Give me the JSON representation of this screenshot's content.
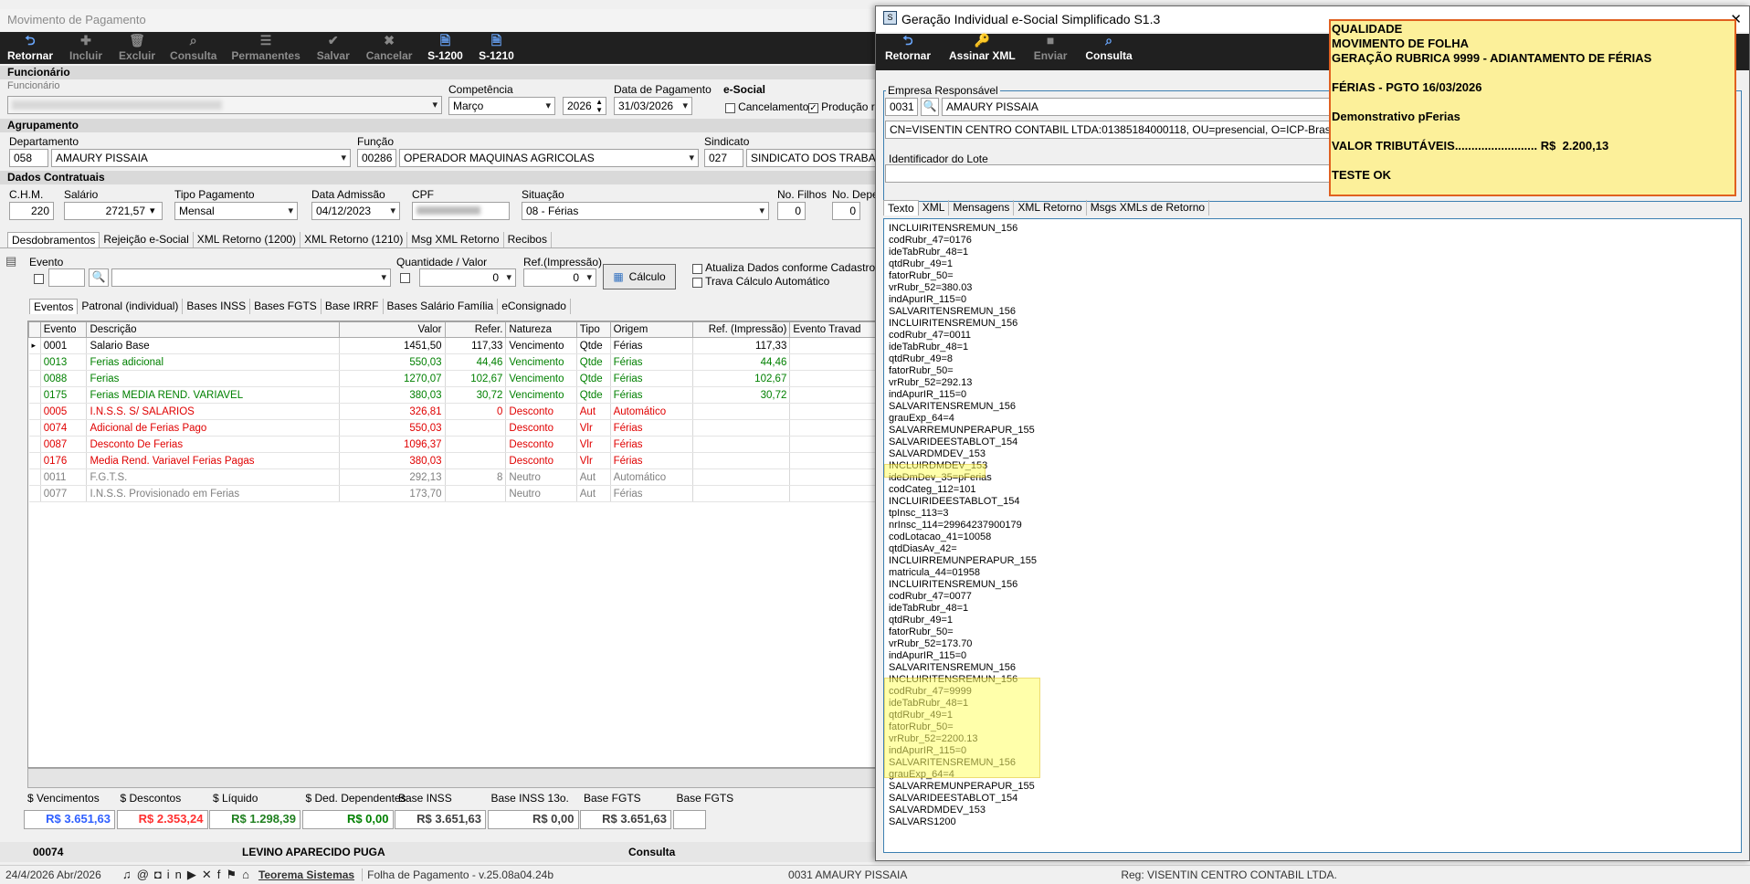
{
  "main": {
    "title": "Movimento de Pagamento",
    "toolbar": [
      {
        "label": "Retornar",
        "icon": "return-icon",
        "enabled": true
      },
      {
        "label": "Incluir",
        "icon": "plus-icon",
        "enabled": false
      },
      {
        "label": "Excluir",
        "icon": "trash-icon",
        "enabled": false
      },
      {
        "label": "Consulta",
        "icon": "search-icon",
        "enabled": false
      },
      {
        "label": "Permanentes",
        "icon": "list-icon",
        "enabled": false
      },
      {
        "label": "Salvar",
        "icon": "check-icon",
        "enabled": false
      },
      {
        "label": "Cancelar",
        "icon": "x-icon",
        "enabled": false
      },
      {
        "label": "S-1200",
        "icon": "doc-icon",
        "enabled": true
      },
      {
        "label": "S-1210",
        "icon": "doc-icon",
        "enabled": true
      }
    ],
    "funcionario_head": "Funcionário",
    "funcionario_label": "Funcionário",
    "competencia_label": "Competência",
    "competencia_mes": "Março",
    "competencia_ano": "2026",
    "data_pag_label": "Data de Pagamento",
    "data_pag": "31/03/2026",
    "esocial_label": "e-Social",
    "cancelamento_label": "Cancelamento",
    "producao_label": "Produção re",
    "agrupamento_head": "Agrupamento",
    "departamento_label": "Departamento",
    "departamento_cod": "058",
    "departamento_nome": "AMAURY PISSAIA",
    "funcao_label": "Função",
    "funcao_cod": "00286",
    "funcao_nome": "OPERADOR MAQUINAS AGRICOLAS",
    "sindicato_label": "Sindicato",
    "sindicato_cod": "027",
    "sindicato_nome": "SINDICATO DOS TRABALH",
    "contratuais_head": "Dados Contratuais",
    "chm_label": "C.H.M.",
    "chm": "220",
    "salario_label": "Salário",
    "salario": "2721,57",
    "tipo_pag_label": "Tipo Pagamento",
    "tipo_pag": "Mensal",
    "admissao_label": "Data Admissão",
    "admissao": "04/12/2023",
    "cpf_label": "CPF",
    "situacao_label": "Situação",
    "situacao": "08 - Férias",
    "filhos_label": "No. Filhos",
    "filhos": "0",
    "depe_label": "No. Depe",
    "depe": "0",
    "tabs1": [
      "Desdobramentos",
      "Rejeição e-Social",
      "XML Retorno (1200)",
      "XML Retorno (1210)",
      "Msg XML Retorno",
      "Recibos"
    ],
    "evento_label": "Evento",
    "qtd_label": "Quantidade / Valor",
    "qtd_val": "0",
    "ref_label": "Ref.(Impressão)",
    "ref_val": "0",
    "calculo_label": "Cálculo",
    "atualiza_label": "Atualiza Dados conforme Cadastro",
    "trava_label": "Trava Cálculo Automático",
    "tabs2": [
      "Eventos",
      "Patronal (individual)",
      "Bases INSS",
      "Bases FGTS",
      "Base IRRF",
      "Bases Salário Família",
      "eConsignado"
    ],
    "grid_headers": [
      "Evento",
      "Descrição",
      "Valor",
      "Refer.",
      "Natureza",
      "Tipo",
      "Origem",
      "Ref. (Impressão)",
      "Evento Travad"
    ],
    "rows": [
      {
        "ev": "0001",
        "desc": "Salario Base",
        "valor": "1451,50",
        "ref": "117,33",
        "nat": "Vencimento",
        "tipo": "Qtde",
        "orig": "Férias",
        "imp": "117,33",
        "color": "#000000"
      },
      {
        "ev": "0013",
        "desc": "Ferias adicional",
        "valor": "550,03",
        "ref": "44,46",
        "nat": "Vencimento",
        "tipo": "Qtde",
        "orig": "Férias",
        "imp": "44,46",
        "color": "#008000"
      },
      {
        "ev": "0088",
        "desc": "Ferias",
        "valor": "1270,07",
        "ref": "102,67",
        "nat": "Vencimento",
        "tipo": "Qtde",
        "orig": "Férias",
        "imp": "102,67",
        "color": "#008000"
      },
      {
        "ev": "0175",
        "desc": "Ferias MEDIA REND. VARIAVEL",
        "valor": "380,03",
        "ref": "30,72",
        "nat": "Vencimento",
        "tipo": "Qtde",
        "orig": "Férias",
        "imp": "30,72",
        "color": "#008000"
      },
      {
        "ev": "0005",
        "desc": "I.N.S.S. S/ SALARIOS",
        "valor": "326,81",
        "ref": "0",
        "nat": "Desconto",
        "tipo": "Aut",
        "orig": "Automático",
        "imp": "",
        "color": "#e00000"
      },
      {
        "ev": "0074",
        "desc": "Adicional de Ferias Pago",
        "valor": "550,03",
        "ref": "",
        "nat": "Desconto",
        "tipo": "Vlr",
        "orig": "Férias",
        "imp": "",
        "color": "#e00000"
      },
      {
        "ev": "0087",
        "desc": "Desconto De Ferias",
        "valor": "1096,37",
        "ref": "",
        "nat": "Desconto",
        "tipo": "Vlr",
        "orig": "Férias",
        "imp": "",
        "color": "#e00000"
      },
      {
        "ev": "0176",
        "desc": "Media  Rend. Variavel Ferias Pagas",
        "valor": "380,03",
        "ref": "",
        "nat": "Desconto",
        "tipo": "Vlr",
        "orig": "Férias",
        "imp": "",
        "color": "#e00000"
      },
      {
        "ev": "0011",
        "desc": "F.G.T.S.",
        "valor": "292,13",
        "ref": "8",
        "nat": "Neutro",
        "tipo": "Aut",
        "orig": "Automático",
        "imp": "",
        "color": "#808080"
      },
      {
        "ev": "0077",
        "desc": "I.N.S.S. Provisionado em Ferias",
        "valor": "173,70",
        "ref": "",
        "nat": "Neutro",
        "tipo": "Aut",
        "orig": "Férias",
        "imp": "",
        "color": "#808080"
      }
    ],
    "totals": [
      {
        "label": "$ Vencimentos",
        "value": "R$ 3.651,63",
        "color": "#3060ff"
      },
      {
        "label": "$ Descontos",
        "value": "R$ 2.353,24",
        "color": "#ff3030"
      },
      {
        "label": "$ Líquido",
        "value": "R$ 1.298,39",
        "color": "#208020"
      },
      {
        "label": "$ Ded. Dependentes",
        "value": "R$ 0,00",
        "color": "#008000"
      },
      {
        "label": "Base INSS",
        "value": "R$ 3.651,63",
        "color": "#404040"
      },
      {
        "label": "Base INSS 13o.",
        "value": "R$ 0,00",
        "color": "#404040"
      },
      {
        "label": "Base FGTS",
        "value": "R$ 3.651,63",
        "color": "#404040"
      },
      {
        "label": "Base FGTS",
        "value": "",
        "color": "#404040"
      }
    ],
    "footer_cod": "00074",
    "footer_nome": "LEVINO APARECIDO PUGA",
    "footer_mode": "Consulta"
  },
  "status": {
    "date": "24/4/2026 Abr/2026",
    "brand": "Teorema Sistemas",
    "version": "Folha de Pagamento - v.25.08a04.24b",
    "empresa": "0031 AMAURY  PISSAIA",
    "reg": "Reg: VISENTIN CENTRO CONTABIL LTDA."
  },
  "dialog": {
    "title": "Geração Individual e-Social Simplificado S1.3",
    "close": "✕",
    "toolbar": [
      {
        "label": "Retornar",
        "icon": "return-icon",
        "enabled": true
      },
      {
        "label": "Assinar XML",
        "icon": "key-icon",
        "enabled": true
      },
      {
        "label": "Enviar",
        "icon": "send-icon",
        "enabled": false
      },
      {
        "label": "Consulta",
        "icon": "search-icon",
        "enabled": true
      }
    ],
    "empresa_label": "Empresa Responsável",
    "empresa_cod": "0031",
    "empresa_nome": "AMAURY  PISSAIA",
    "certificado": "CN=VISENTIN CENTRO CONTABIL LTDA:01385184000118, OU=presencial, O=ICP-Brasil, C=BR, S",
    "lote_label": "Identificador do Lote",
    "tabs": [
      "Texto",
      "XML",
      "Mensagens",
      "XML Retorno",
      "Msgs XMLs de Retorno"
    ],
    "xml_lines": [
      "INCLUIRITENSREMUN_156",
      "codRubr_47=0176",
      "ideTabRubr_48=1",
      "qtdRubr_49=1",
      "fatorRubr_50=",
      "vrRubr_52=380.03",
      "indApurIR_115=0",
      "SALVARITENSREMUN_156",
      "INCLUIRITENSREMUN_156",
      "codRubr_47=0011",
      "ideTabRubr_48=1",
      "qtdRubr_49=8",
      "fatorRubr_50=",
      "vrRubr_52=292.13",
      "indApurIR_115=0",
      "SALVARITENSREMUN_156",
      "grauExp_64=4",
      "SALVARREMUNPERAPUR_155",
      "SALVARIDEESTABLOT_154",
      "SALVARDMDEV_153",
      "INCLUIRDMDEV_153",
      "ideDmDev_35=pFerias",
      "codCateg_112=101",
      "INCLUIRIDEESTABLOT_154",
      "tpInsc_113=3",
      "nrInsc_114=29964237900179",
      "codLotacao_41=10058",
      "qtdDiasAv_42=",
      "INCLUIRREMUNPERAPUR_155",
      "matricula_44=01958",
      "INCLUIRITENSREMUN_156",
      "codRubr_47=0077",
      "ideTabRubr_48=1",
      "qtdRubr_49=1",
      "fatorRubr_50=",
      "vrRubr_52=173.70",
      "indApurIR_115=0",
      "SALVARITENSREMUN_156",
      "INCLUIRITENSREMUN_156",
      "codRubr_47=9999",
      "ideTabRubr_48=1",
      "qtdRubr_49=1",
      "fatorRubr_50=",
      "vrRubr_52=2200.13",
      "indApurIR_115=0",
      "SALVARITENSREMUN_156",
      "grauExp_64=4",
      "SALVARREMUNPERAPUR_155",
      "SALVARIDEESTABLOT_154",
      "SALVARDMDEV_153",
      "SALVARS1200"
    ],
    "note": "QUALIDADE\nMOVIMENTO DE FOLHA\nGERAÇÃO RUBRICA 9999 - ADIANTAMENTO DE FÉRIAS\n\nFÉRIAS - PGTO 16/03/2026\n\nDemonstrativo pFerias\n\nVALOR TRIBUTÁVEIS......................... R$  2.200,13\n\nTESTE OK"
  }
}
